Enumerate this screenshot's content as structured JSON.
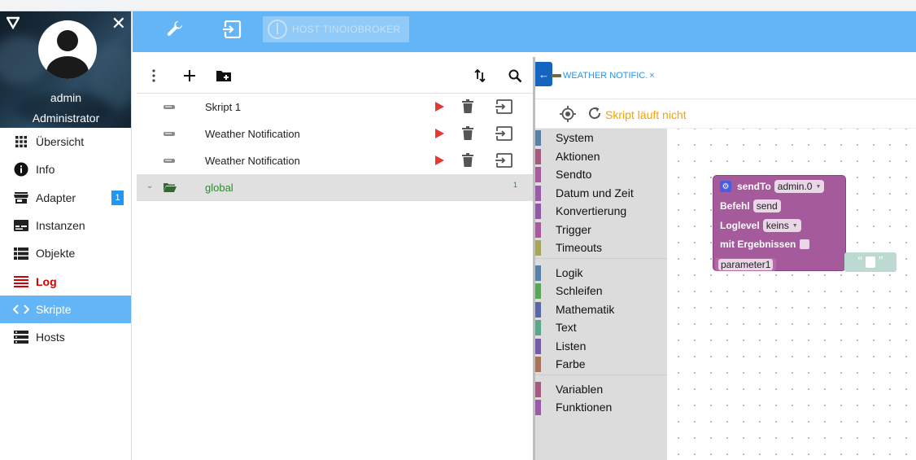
{
  "user": {
    "name": "admin",
    "role": "Administrator"
  },
  "nav": [
    {
      "label": "Übersicht",
      "icon": "grid-icon"
    },
    {
      "label": "Info",
      "icon": "info-icon"
    },
    {
      "label": "Adapter",
      "icon": "store-icon",
      "badge": "1"
    },
    {
      "label": "Instanzen",
      "icon": "instances-icon"
    },
    {
      "label": "Objekte",
      "icon": "list-icon"
    },
    {
      "label": "Log",
      "icon": "log-icon"
    },
    {
      "label": "Skripte",
      "icon": "code-icon"
    },
    {
      "label": "Hosts",
      "icon": "server-icon"
    }
  ],
  "appbar": {
    "host": "HOST TINOIOBROKER"
  },
  "scripts": [
    {
      "name": "Skript 1"
    },
    {
      "name": "Weather Notification"
    },
    {
      "name": "Weather Notification"
    }
  ],
  "folder": {
    "name": "global",
    "count": "1"
  },
  "editor": {
    "tab_title": "WEATHER NOTIFIC.",
    "tab_close": "×",
    "status": "Skript läuft nicht"
  },
  "toolbox": {
    "group1": [
      {
        "label": "System",
        "color": "#5b80a5"
      },
      {
        "label": "Aktionen",
        "color": "#a55b80"
      },
      {
        "label": "Sendto",
        "color": "#a55b9b"
      },
      {
        "label": "Datum und Zeit",
        "color": "#995ba5"
      },
      {
        "label": "Konvertierung",
        "color": "#8e5ba5"
      },
      {
        "label": "Trigger",
        "color": "#a55b9b"
      },
      {
        "label": "Timeouts",
        "color": "#a5a55b"
      }
    ],
    "group2": [
      {
        "label": "Logik",
        "color": "#5b80a5"
      },
      {
        "label": "Schleifen",
        "color": "#5ba55b"
      },
      {
        "label": "Mathematik",
        "color": "#5b67a5"
      },
      {
        "label": "Text",
        "color": "#5ba58c"
      },
      {
        "label": "Listen",
        "color": "#745ba5"
      },
      {
        "label": "Farbe",
        "color": "#a5745b"
      }
    ],
    "group3": [
      {
        "label": "Variablen",
        "color": "#a55b80"
      },
      {
        "label": "Funktionen",
        "color": "#995ba5"
      }
    ]
  },
  "block": {
    "title": "sendTo",
    "instance": "admin.0",
    "command_label": "Befehl",
    "command_value": "send",
    "loglevel_label": "Loglevel",
    "loglevel_value": "keins",
    "results_label": "mit Ergebnissen",
    "param": "parameter1",
    "quote_open": "“",
    "quote_close": "”"
  }
}
